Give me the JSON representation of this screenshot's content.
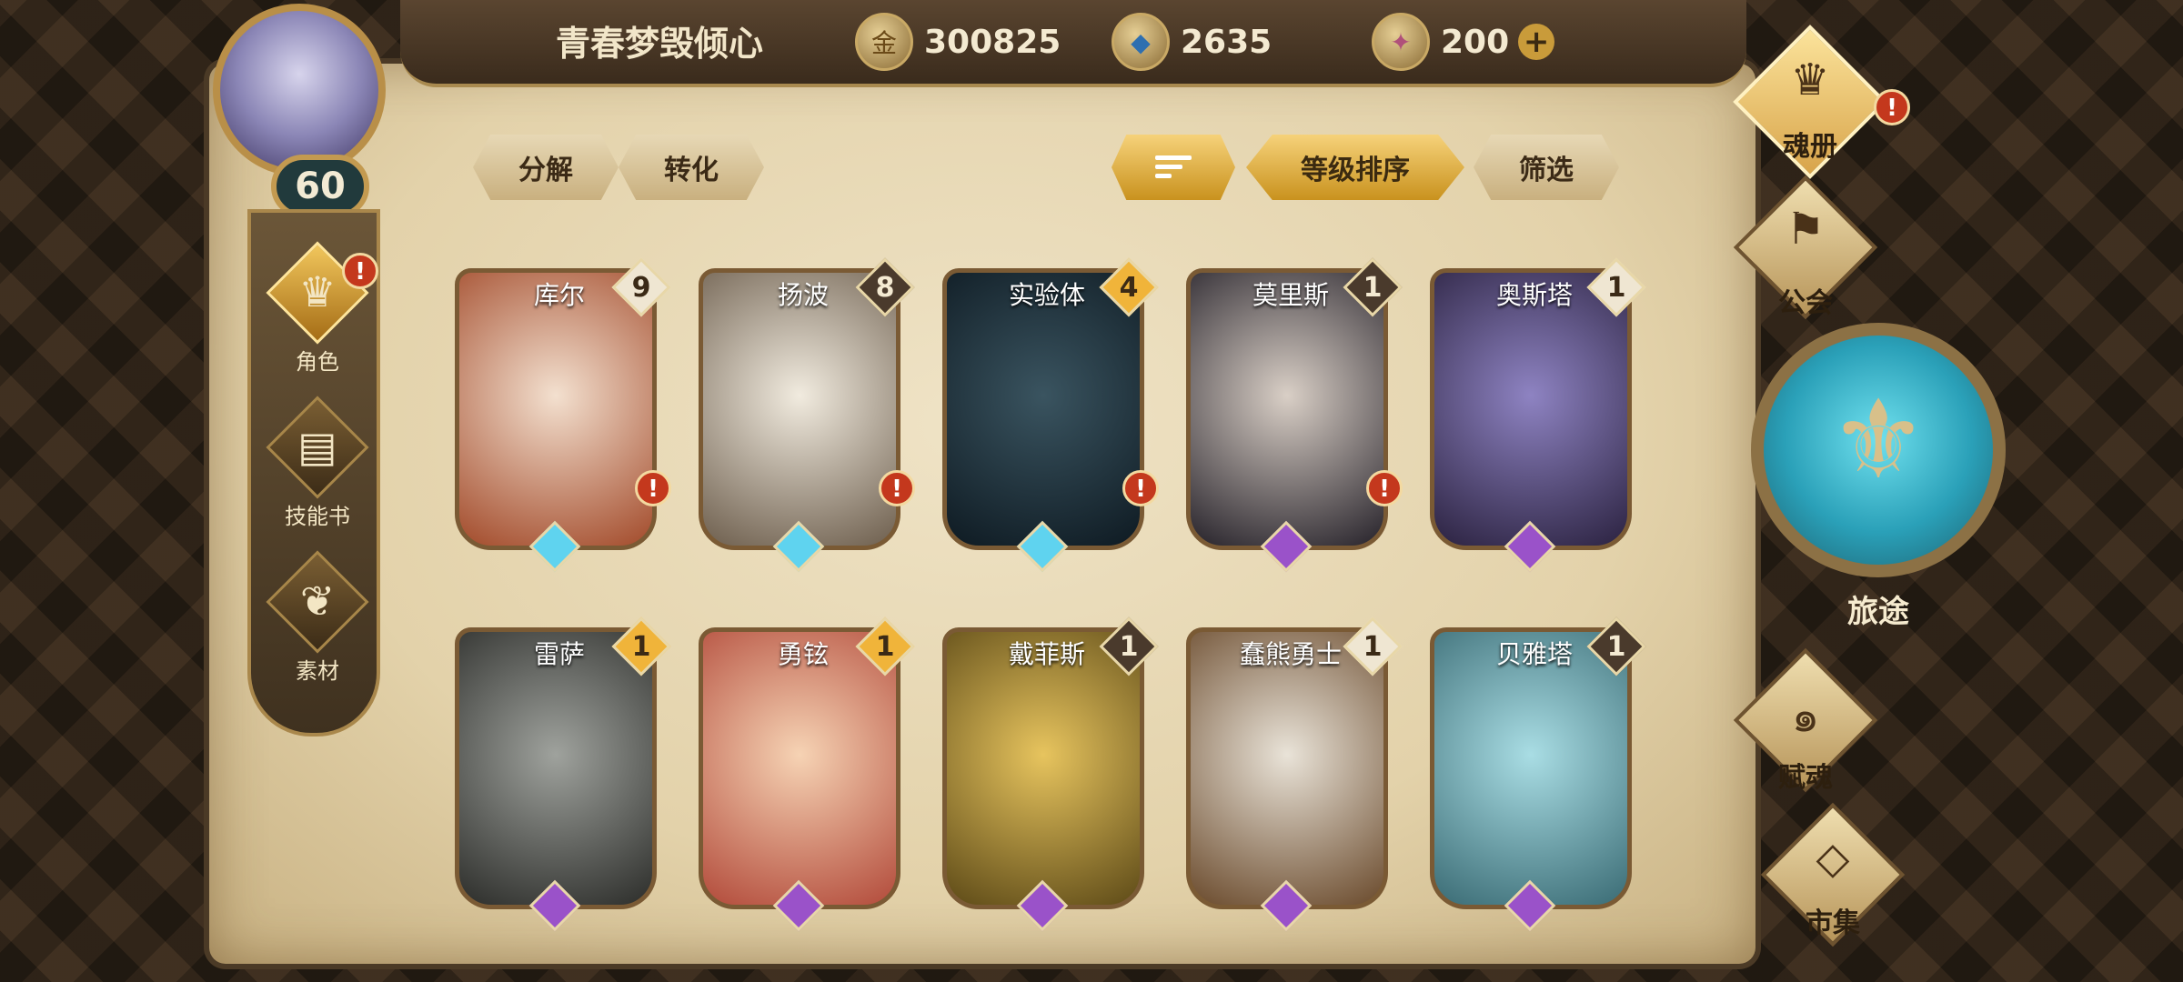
{
  "player": {
    "name": "青春梦毁倾心",
    "level": "60"
  },
  "currencies": [
    {
      "icon": "gold-coin-icon",
      "glyph": "金",
      "value": "300825"
    },
    {
      "icon": "blue-crystal-icon",
      "glyph": "◆",
      "value": "2635"
    },
    {
      "icon": "pink-gem-icon",
      "glyph": "✦",
      "value": "200"
    }
  ],
  "leftnav": [
    {
      "label": "角色",
      "glyph": "♛",
      "alert": "!"
    },
    {
      "label": "技能书",
      "glyph": "▤"
    },
    {
      "label": "素材",
      "glyph": "❦"
    }
  ],
  "actions": {
    "decompose": "分解",
    "convert": "转化",
    "level_sort": "等级排序",
    "filter": "筛选"
  },
  "cards": [
    {
      "name": "库尔",
      "count": "9",
      "rarity": "blue",
      "alert": "!",
      "art": [
        "#f3e0cf",
        "#a24a2a"
      ]
    },
    {
      "name": "扬波",
      "count": "8",
      "rarity": "blue",
      "alert": "!",
      "art": [
        "#f1ebdf",
        "#6d5e4d"
      ]
    },
    {
      "name": "实验体",
      "count": "4",
      "rarity": "blue",
      "alert": "!",
      "art": [
        "#3a5460",
        "#0e1a22"
      ]
    },
    {
      "name": "莫里斯",
      "count": "1",
      "rarity": "purple",
      "alert": "!",
      "art": [
        "#d9cfc6",
        "#26222a"
      ]
    },
    {
      "name": "奥斯塔",
      "count": "1",
      "rarity": "purple",
      "alert": "",
      "art": [
        "#8e83c2",
        "#2b2240"
      ]
    },
    {
      "name": "雷萨",
      "count": "1",
      "rarity": "purple",
      "alert": "",
      "art": [
        "#9fa29d",
        "#2c2d2a"
      ]
    },
    {
      "name": "勇铉",
      "count": "1",
      "rarity": "purple",
      "alert": "",
      "art": [
        "#f6d3b4",
        "#b24a3a"
      ]
    },
    {
      "name": "戴菲斯",
      "count": "1",
      "rarity": "purple",
      "alert": "",
      "art": [
        "#e7c45e",
        "#5d4a17"
      ]
    },
    {
      "name": "蠢熊勇士",
      "count": "1",
      "rarity": "purple",
      "alert": "",
      "art": [
        "#e9e3d8",
        "#6a4a2c"
      ]
    },
    {
      "name": "贝雅塔",
      "count": "1",
      "rarity": "purple",
      "alert": "",
      "art": [
        "#a9dde4",
        "#3a6b74"
      ]
    }
  ],
  "rightnav": {
    "soul_book": {
      "label": "魂册",
      "alert": "!"
    },
    "guild": {
      "label": "公会"
    },
    "journey": {
      "label": "旅途"
    },
    "endow_soul": {
      "label": "赋魂"
    },
    "market": {
      "label": "市集"
    }
  },
  "colors": {
    "count_gold": "#f0b43a",
    "count_dark": "#4a3a2c",
    "count_light": "#efe6d2"
  }
}
